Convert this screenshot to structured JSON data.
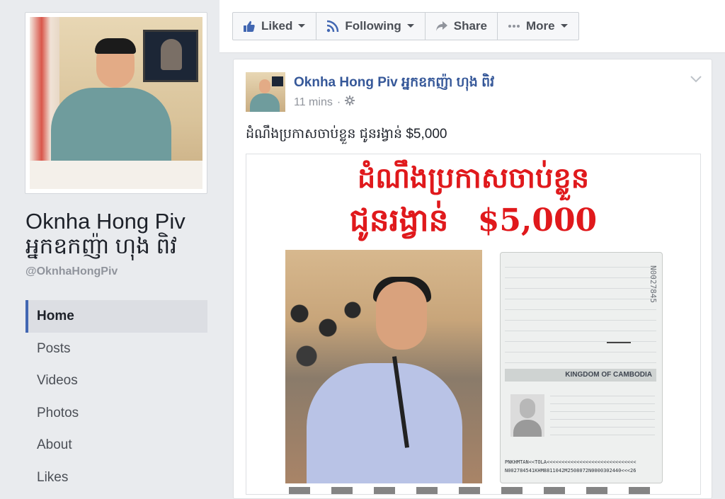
{
  "sidebar": {
    "page_name_en": "Oknha Hong Piv",
    "page_name_km": "អ្នកឧកញ៉ា ហុង ពិវ",
    "handle": "@OknhaHongPiv",
    "nav": [
      {
        "label": "Home",
        "active": true
      },
      {
        "label": "Posts"
      },
      {
        "label": "Videos"
      },
      {
        "label": "Photos"
      },
      {
        "label": "About"
      },
      {
        "label": "Likes"
      }
    ]
  },
  "toolbar": {
    "liked_label": "Liked",
    "following_label": "Following",
    "share_label": "Share",
    "more_label": "More"
  },
  "post": {
    "author": "Oknha Hong Piv អ្នកឧកញ៉ា ហុង ពិវ",
    "time": "11 mins",
    "text": "ដំណឹងប្រកាសចាប់ខ្លួន ជូនរង្វាន់ $5,000",
    "poster": {
      "line1": "ដំណឹងប្រកាសចាប់ខ្លួន",
      "line2_reward": "ជូនរង្វាន់",
      "line2_amount": "$5,000",
      "passport_country": "KINGDOM OF CAMBODIA",
      "passport_number": "N0027845",
      "mrz_line1": "PNKHMTAN<<TOLA<<<<<<<<<<<<<<<<<<<<<<<<<<<<<<",
      "mrz_line2": "N002784541KHM8811042M2508072N0000302440<<<26"
    }
  },
  "colors": {
    "brand_blue": "#4267b2",
    "link_blue": "#365899",
    "poster_red": "#e0191c"
  },
  "icons": {
    "liked": "thumbs-up-icon",
    "following": "rss-icon",
    "share": "share-arrow-icon",
    "more": "ellipsis-icon",
    "globe": "gear-icon",
    "chevron": "chevron-down-icon"
  }
}
